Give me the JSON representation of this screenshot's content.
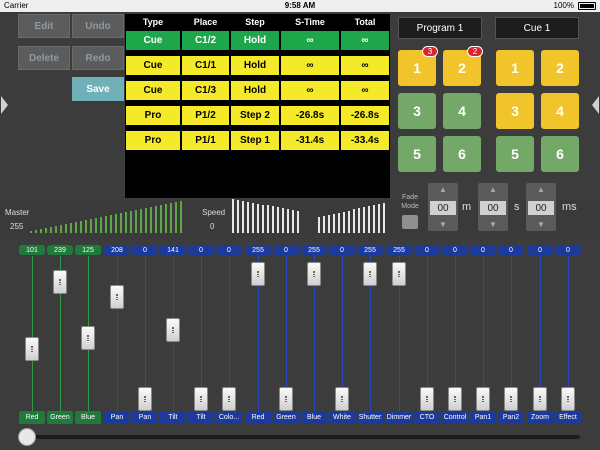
{
  "status": {
    "carrier": "Carrier",
    "time": "9:58 AM",
    "battery": "100%"
  },
  "edit_buttons": {
    "edit": "Edit",
    "undo": "Undo",
    "delete": "Delete",
    "redo": "Redo",
    "save": "Save"
  },
  "cue_table": {
    "headers": [
      "Type",
      "Place",
      "Step",
      "S-Time",
      "Total"
    ],
    "rows": [
      [
        "Cue",
        "C1/2",
        "Hold",
        "∞",
        "∞"
      ],
      [
        "Cue",
        "C1/1",
        "Hold",
        "∞",
        "∞"
      ],
      [
        "Cue",
        "C1/3",
        "Hold",
        "∞",
        "∞"
      ],
      [
        "Pro",
        "P1/2",
        "Step 2",
        "-26.8s",
        "-26.8s"
      ],
      [
        "Pro",
        "P1/1",
        "Step 1",
        "-31.4s",
        "-33.4s"
      ]
    ],
    "row_colors": [
      "green",
      "yellow",
      "yellow",
      "yellow",
      "yellow"
    ]
  },
  "program": {
    "title": "Program 1",
    "pads": [
      {
        "label": "1",
        "color": "yellow",
        "badge": "3"
      },
      {
        "label": "2",
        "color": "yellow",
        "badge": "2"
      },
      {
        "label": "3",
        "color": "green",
        "badge": ""
      },
      {
        "label": "4",
        "color": "green",
        "badge": ""
      },
      {
        "label": "5",
        "color": "green",
        "badge": ""
      },
      {
        "label": "6",
        "color": "green",
        "badge": ""
      }
    ]
  },
  "cue": {
    "title": "Cue 1",
    "pads": [
      {
        "label": "1",
        "color": "yellow"
      },
      {
        "label": "2",
        "color": "yellow"
      },
      {
        "label": "3",
        "color": "yellow"
      },
      {
        "label": "4",
        "color": "yellow"
      },
      {
        "label": "5",
        "color": "green"
      },
      {
        "label": "6",
        "color": "green"
      }
    ]
  },
  "fade": {
    "label_line1": "Fade",
    "label_line2": "Mode",
    "m": "00",
    "s": "00",
    "ms": "00",
    "unit_m": "m",
    "unit_s": "s",
    "unit_ms": "ms"
  },
  "levels": {
    "master_label": "Master",
    "master_value": "255",
    "speed_label": "Speed",
    "speed_value": "0"
  },
  "channels": [
    {
      "label": "Red",
      "value": "101",
      "color": "green",
      "level": 0.4
    },
    {
      "label": "Green",
      "value": "239",
      "color": "green",
      "level": 0.94
    },
    {
      "label": "Blue",
      "value": "125",
      "color": "green",
      "level": 0.49
    },
    {
      "label": "Pan",
      "value": "208",
      "color": "blue",
      "level": 0.82
    },
    {
      "label": "Pan",
      "value": "0",
      "color": "blue",
      "level": 0.0
    },
    {
      "label": "Tilt",
      "value": "141",
      "color": "blue",
      "level": 0.55
    },
    {
      "label": "Tilt",
      "value": "0",
      "color": "blue",
      "level": 0.0
    },
    {
      "label": "Colo...",
      "value": "0",
      "color": "blue",
      "level": 0.0
    },
    {
      "label": "Red",
      "value": "255",
      "color": "blue",
      "level": 1.0
    },
    {
      "label": "Green",
      "value": "0",
      "color": "blue",
      "level": 0.0
    },
    {
      "label": "Blue",
      "value": "255",
      "color": "blue",
      "level": 1.0
    },
    {
      "label": "White",
      "value": "0",
      "color": "blue",
      "level": 0.0
    },
    {
      "label": "Shutter",
      "value": "255",
      "color": "blue",
      "level": 1.0
    },
    {
      "label": "Dimmer",
      "value": "255",
      "color": "blue",
      "level": 1.0
    },
    {
      "label": "CTO",
      "value": "0",
      "color": "blue",
      "level": 0.0
    },
    {
      "label": "Control",
      "value": "0",
      "color": "blue",
      "level": 0.0
    },
    {
      "label": "Pan1",
      "value": "0",
      "color": "blue",
      "level": 0.0
    },
    {
      "label": "Pan2",
      "value": "0",
      "color": "blue",
      "level": 0.0
    },
    {
      "label": "Zoom",
      "value": "0",
      "color": "blue",
      "level": 0.0
    },
    {
      "label": "Effect",
      "value": "0",
      "color": "blue",
      "level": 0.0
    }
  ],
  "bottom_slider": {
    "position": 0.0
  },
  "colors": {
    "cue_green": "#1ea64a",
    "cue_yellow": "#f5ea2a",
    "badge_green": "#1f7a3c",
    "badge_blue": "#1c3a9b",
    "track_green": "#2e9a46",
    "track_blue": "#2748b8"
  }
}
